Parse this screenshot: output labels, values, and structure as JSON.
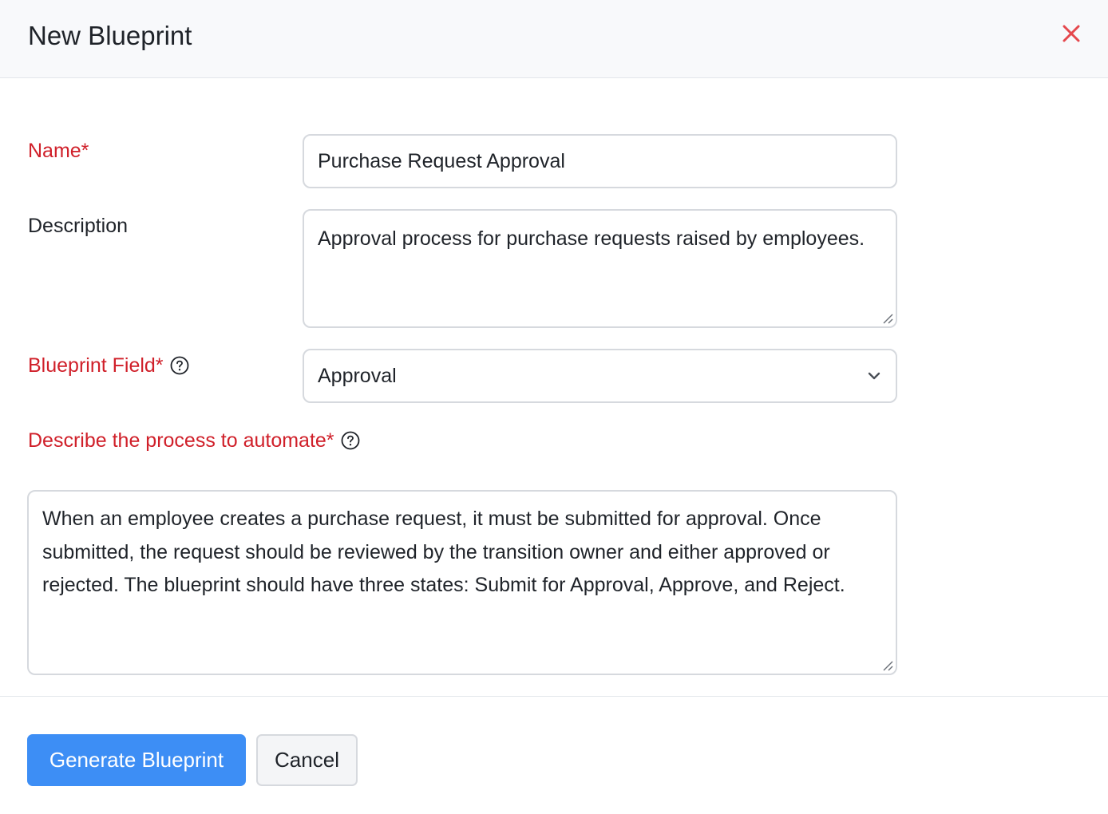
{
  "dialog": {
    "title": "New Blueprint"
  },
  "form": {
    "name_label": "Name*",
    "name_value": "Purchase Request Approval",
    "description_label": "Description",
    "description_value": "Approval process for purchase requests raised by employees.",
    "blueprint_field_label": "Blueprint Field*",
    "blueprint_field_value": "Approval",
    "process_label": "Describe the process to automate*",
    "process_value": "When an employee creates a purchase request, it must be submitted for approval. Once submitted, the request should be reviewed by the transition owner and either approved or rejected. The blueprint should have three states: Submit for Approval, Approve, and Reject."
  },
  "footer": {
    "primary_label": "Generate Blueprint",
    "secondary_label": "Cancel"
  },
  "icons": {
    "close": "close-icon",
    "help": "help-circle-icon",
    "dropdown": "chevron-down-icon",
    "resize": "resize-grip-icon"
  },
  "colors": {
    "required_label": "#d0202a",
    "close_icon": "#e5484d",
    "primary_button": "#3d8ef5",
    "header_bg": "#f8f9fb"
  }
}
